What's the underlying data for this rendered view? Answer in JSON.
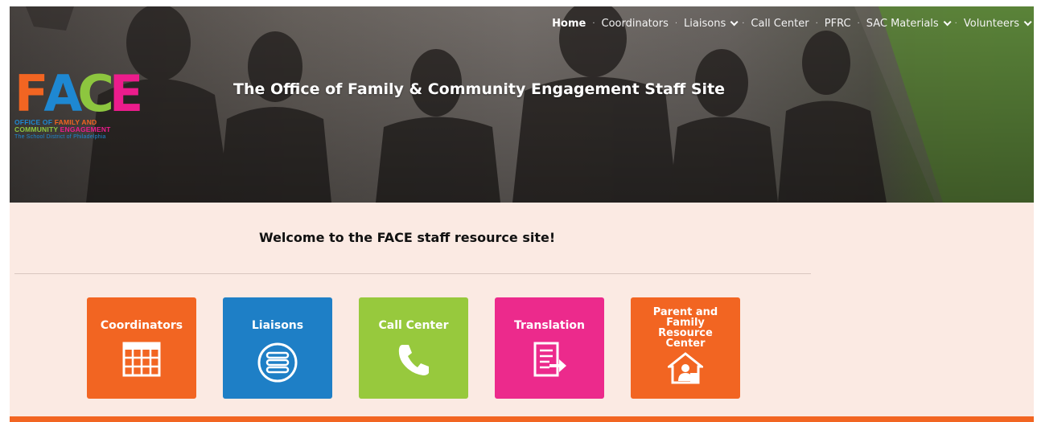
{
  "nav": {
    "items": [
      {
        "label": "Home",
        "active": true,
        "dropdown": false
      },
      {
        "label": "Coordinators",
        "active": false,
        "dropdown": false
      },
      {
        "label": "Liaisons",
        "active": false,
        "dropdown": true
      },
      {
        "label": "Call Center",
        "active": false,
        "dropdown": false
      },
      {
        "label": "PFRC",
        "active": false,
        "dropdown": false
      },
      {
        "label": "SAC Materials",
        "active": false,
        "dropdown": true
      },
      {
        "label": "Volunteers",
        "active": false,
        "dropdown": true
      }
    ]
  },
  "logo": {
    "letters": [
      "F",
      "A",
      "C",
      "E"
    ],
    "line1_a": "OFFICE OF ",
    "line1_b": "FAMILY AND",
    "line2_a": "COMMUNITY ",
    "line2_b": "ENGAGEMENT",
    "line3": "The School District of Philadelphia"
  },
  "hero": {
    "title": "The Office of Family & Community Engagement Staff Site"
  },
  "content": {
    "welcome": "Welcome to the FACE staff resource site!"
  },
  "tiles": [
    {
      "label": "Coordinators",
      "icon": "calendar-grid-icon",
      "color": "#f26522"
    },
    {
      "label": "Liaisons",
      "icon": "list-circle-icon",
      "color": "#1e7fc6"
    },
    {
      "label": "Call Center",
      "icon": "phone-icon",
      "color": "#97c93d"
    },
    {
      "label": "Translation",
      "icon": "document-arrow-icon",
      "color": "#ec2a8c"
    },
    {
      "label": "Parent and\nFamily\nResource\nCenter",
      "icon": "house-person-icon",
      "color": "#f26522"
    }
  ],
  "colors": {
    "accent_orange": "#f26522",
    "content_bg": "#fbeae3"
  }
}
